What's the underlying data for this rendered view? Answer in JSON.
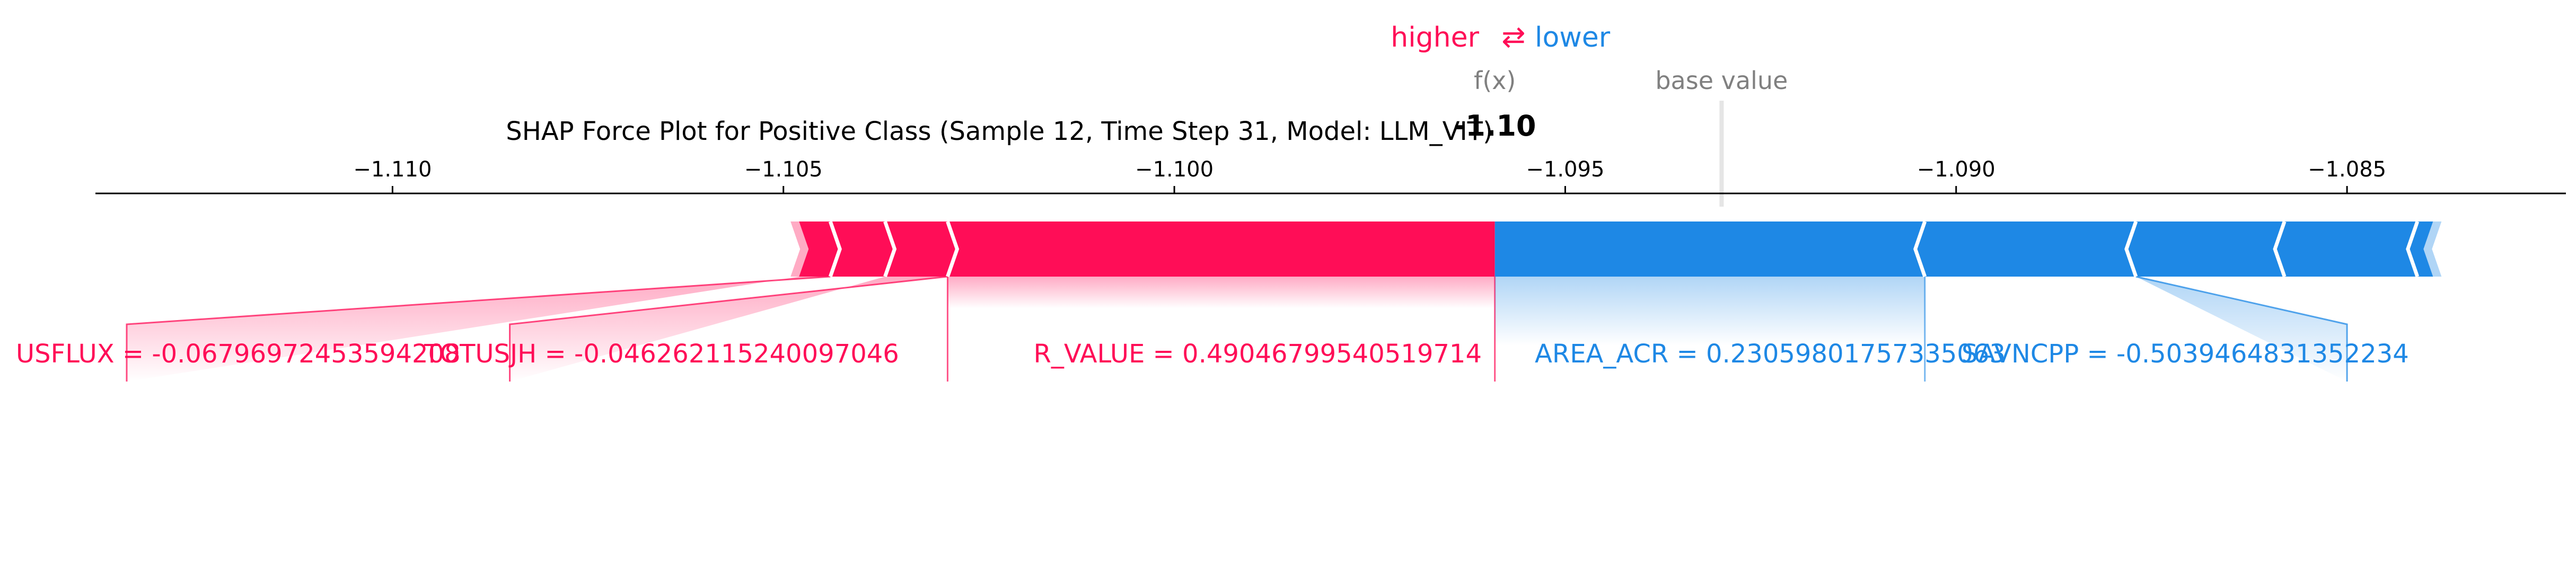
{
  "chart_data": {
    "type": "force",
    "title": "SHAP Force Plot for Positive Class (Sample 12, Time Step 31, Model: LLM_VIT)",
    "legend": {
      "higher": "higher",
      "arrow": "⇄",
      "lower": "lower"
    },
    "fx_label": "f(x)",
    "fx_value_label": "-1.10",
    "fx_value": -1.0959,
    "base_value_label": "base value",
    "base_value": -1.093,
    "xlim": [
      -1.1138,
      -1.0822
    ],
    "ticks": [
      -1.11,
      -1.105,
      -1.1,
      -1.095,
      -1.09,
      -1.085
    ],
    "tick_labels": [
      "−1.110",
      "−1.105",
      "−1.100",
      "−1.095",
      "−1.090",
      "−1.085"
    ],
    "positive_segments": [
      {
        "from": -1.1048,
        "to": -1.1044
      },
      {
        "from": -1.1044,
        "to": -1.1037
      },
      {
        "from": -1.1037,
        "to": -1.1029
      },
      {
        "from": -1.1029,
        "to": -1.0959
      }
    ],
    "negative_segments": [
      {
        "from": -1.0959,
        "to": -1.0904
      },
      {
        "from": -1.0904,
        "to": -1.0877
      },
      {
        "from": -1.0877,
        "to": -1.0858
      },
      {
        "from": -1.0858,
        "to": -1.0841
      },
      {
        "from": -1.0841,
        "to": -1.0839
      }
    ],
    "positive_labels": [
      {
        "text": "USFLUX = -0.06796972453594208",
        "seg_from": -1.1048,
        "seg_to": -1.1044,
        "label_x": -1.1134
      },
      {
        "text": "TOTUSJH = -0.04626211524009704​6",
        "seg_from": -1.1037,
        "seg_to": -1.1029,
        "label_x": -1.1085
      },
      {
        "text": "R_VALUE = 0.49046799540519714",
        "seg_from": -1.1029,
        "seg_to": -1.0959,
        "label_x": -1.103
      }
    ],
    "negative_labels": [
      {
        "text": "AREA_ACR = 0.2305980175733",
        "seg_from": -1.0959,
        "seg_to": -1.0904,
        "label_x": -1.0903
      },
      {
        "text": "5063",
        "seg_from": -1.0959,
        "seg_to": -1.0904,
        "label_x": -1.0903,
        "continuation": true
      },
      {
        "text": "SAVNCPP = -0.5039464831352234",
        "seg_from": -1.0904,
        "seg_to": -1.0877,
        "label_x": -1.085
      }
    ],
    "colors": {
      "positive": "#ff0d57",
      "negative": "#1e88e5",
      "base_line": "#cccccc",
      "text_gray": "#808080",
      "axis": "#000000"
    }
  }
}
